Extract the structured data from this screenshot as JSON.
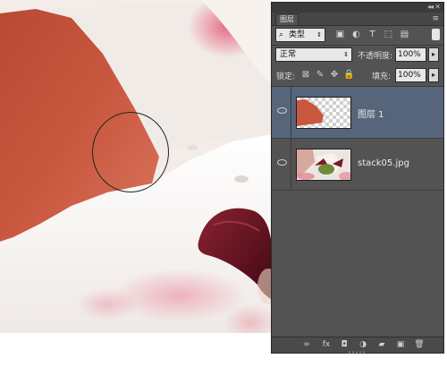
{
  "panel": {
    "tab_label": "图层",
    "filter": {
      "search_icon": "⌕",
      "label": "类型",
      "arrow": "⇕"
    },
    "filter_icons": [
      "▣",
      "◐",
      "T",
      "⬚",
      "▤"
    ],
    "blend_mode": "正常",
    "opacity_label": "不透明度:",
    "opacity_value": "100%",
    "lock_label": "锁定:",
    "lock_icons": [
      "⊠",
      "✎",
      "✥",
      "🔒"
    ],
    "fill_label": "填充:",
    "fill_value": "100%",
    "layers": [
      {
        "name": "图层 1",
        "selected": true
      },
      {
        "name": "stack05.jpg",
        "selected": false
      }
    ],
    "footer_icons": [
      "∞",
      "fx",
      "◘",
      "◑",
      "▰",
      "▣",
      "🗑"
    ]
  },
  "colors": {
    "panel_bg": "#535353",
    "selected_layer": "#56657a",
    "petal_red": "#c9573f",
    "stamen_dark": "#6a1420"
  }
}
